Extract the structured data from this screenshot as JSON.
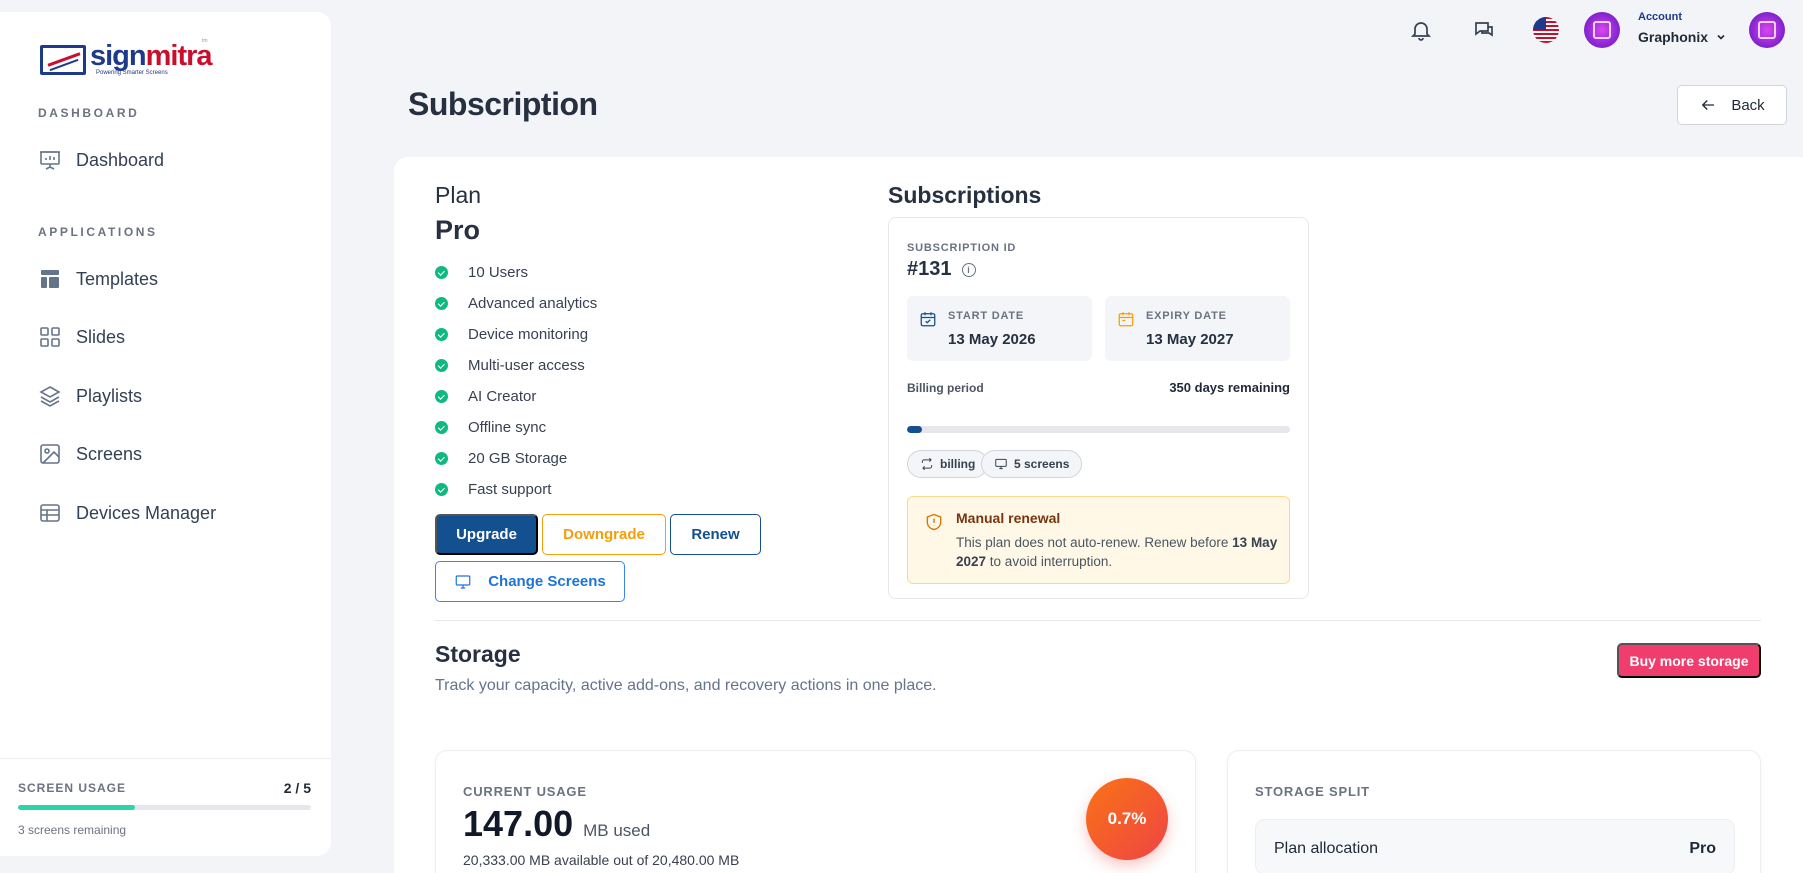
{
  "brand": {
    "name_part1": "sign",
    "name_part2": "mitra",
    "tagline": "Powering Smarter Screens",
    "tm": "tm"
  },
  "sidebar": {
    "sections": [
      {
        "title": "DASHBOARD",
        "items": [
          {
            "label": "Dashboard",
            "icon": "presentation-chart-icon"
          }
        ]
      },
      {
        "title": "APPLICATIONS",
        "items": [
          {
            "label": "Templates",
            "icon": "template-icon"
          },
          {
            "label": "Slides",
            "icon": "grid-icon"
          },
          {
            "label": "Playlists",
            "icon": "layers-icon"
          },
          {
            "label": "Screens",
            "icon": "image-icon"
          },
          {
            "label": "Devices Manager",
            "icon": "table-icon"
          }
        ]
      }
    ],
    "screen_usage": {
      "label": "SCREEN USAGE",
      "value": "2 / 5",
      "used": 2,
      "total": 5,
      "remaining": "3 screens remaining",
      "color": "#2dd4a4"
    }
  },
  "topbar": {
    "account_label": "Account",
    "account_name": "Graphonix"
  },
  "page": {
    "title": "Subscription",
    "back_label": "Back"
  },
  "plan": {
    "heading": "Plan",
    "name": "Pro",
    "features": [
      "10 Users",
      "Advanced analytics",
      "Device monitoring",
      "Multi-user access",
      "AI Creator",
      "Offline sync",
      "20 GB Storage",
      "Fast support"
    ],
    "buttons": {
      "upgrade": "Upgrade",
      "downgrade": "Downgrade",
      "renew": "Renew",
      "change_screens": "Change Screens"
    }
  },
  "subscriptions": {
    "heading": "Subscriptions",
    "id_label": "SUBSCRIPTION ID",
    "id_value": "#131",
    "start_label": "START DATE",
    "start_value": "13 May 2026",
    "expiry_label": "EXPIRY DATE",
    "expiry_value": "13 May 2027",
    "billing_label": "Billing period",
    "days_remaining": "350 days remaining",
    "billing_progress": 0.04,
    "chips": {
      "billing": "billing",
      "screens": "5 screens"
    },
    "notice": {
      "title": "Manual renewal",
      "text_before": "This plan does not auto-renew. Renew before ",
      "date": "13 May 2027",
      "text_after": " to avoid interruption."
    }
  },
  "storage": {
    "heading": "Storage",
    "subtitle": "Track your capacity, active add-ons, and recovery actions in one place.",
    "buy_label": "Buy more storage",
    "current": {
      "label": "CURRENT USAGE",
      "value": "147.00",
      "unit": "MB used",
      "available": "20,333.00 MB available out of 20,480.00 MB",
      "percent": "0.7%"
    },
    "split": {
      "label": "STORAGE SPLIT",
      "row_key": "Plan allocation",
      "row_value": "Pro"
    }
  },
  "colors": {
    "primary": "#12508f",
    "warning": "#f59e0b",
    "danger": "#ef3e6d",
    "success": "#10b981"
  }
}
